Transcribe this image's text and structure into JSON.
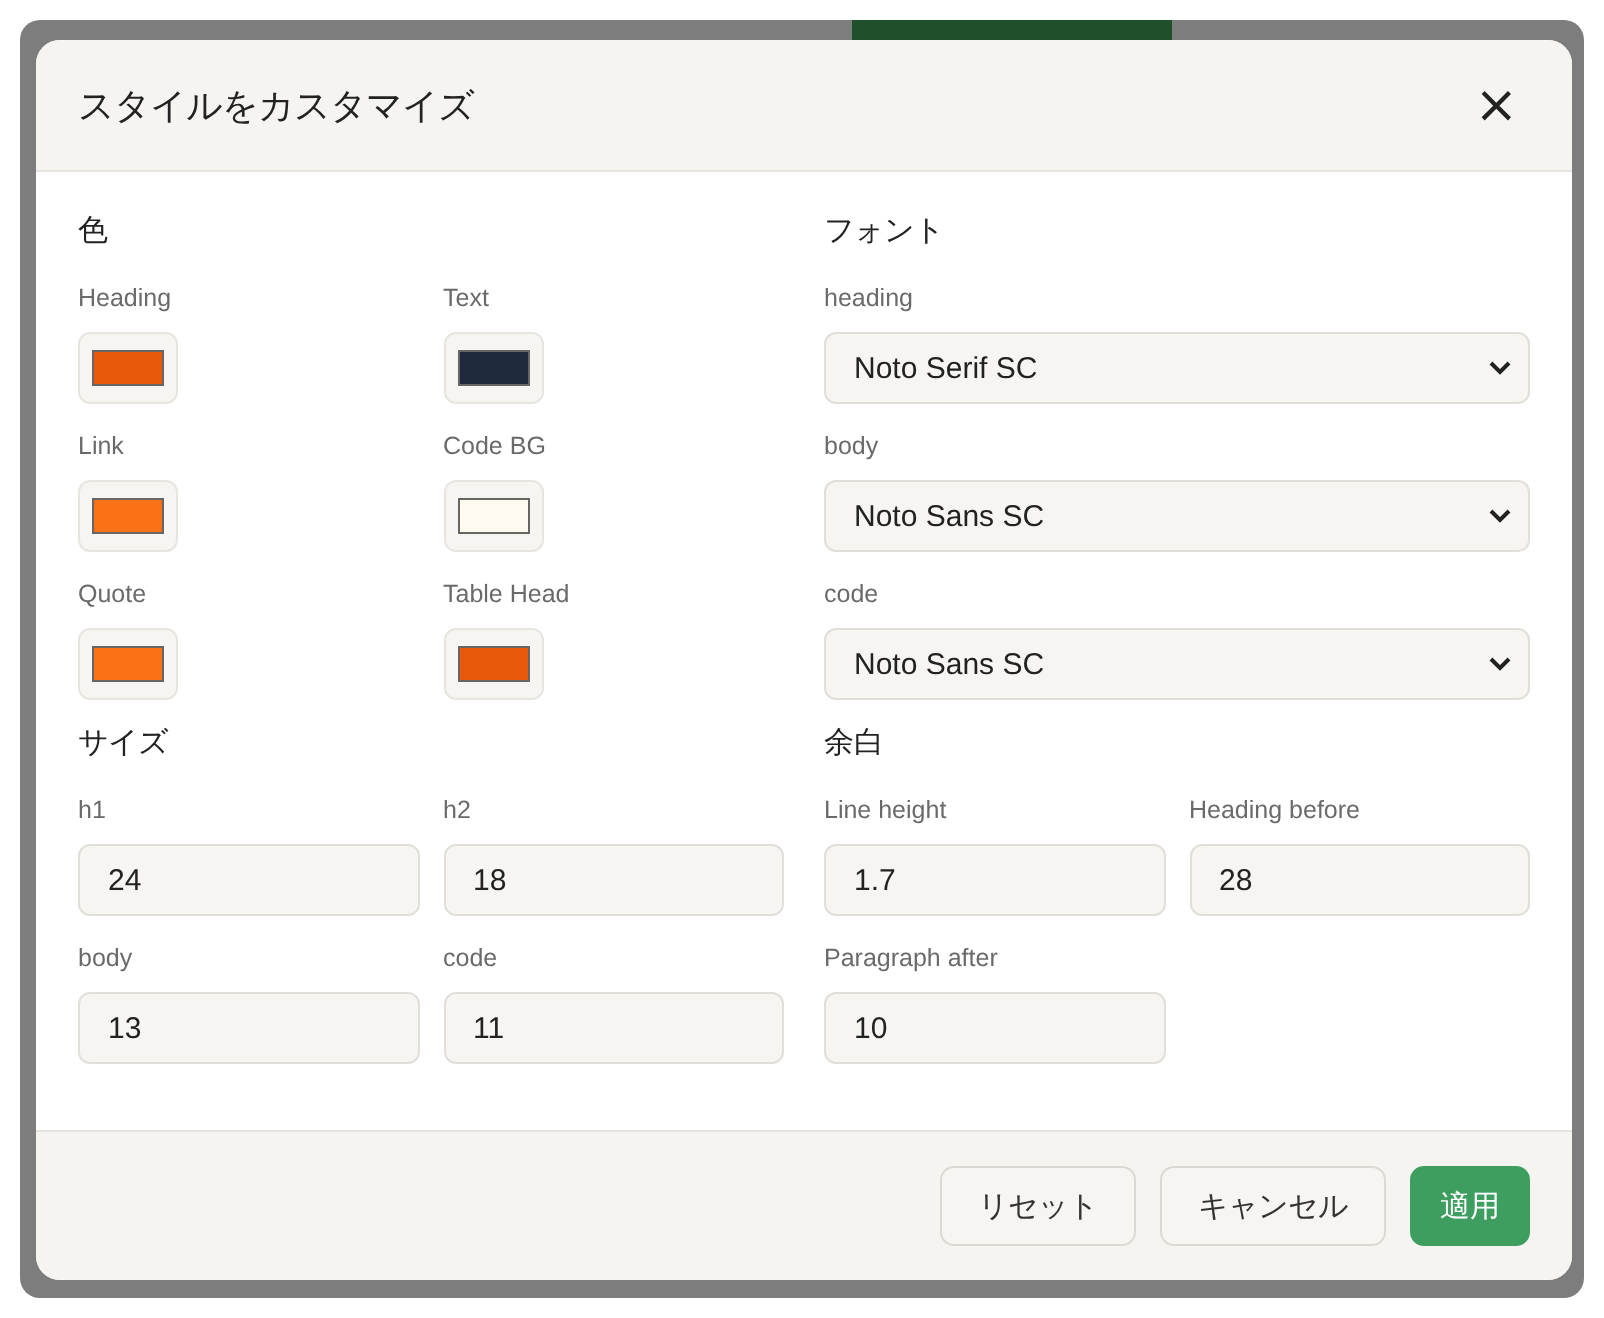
{
  "dialog": {
    "title": "スタイルをカスタマイズ",
    "close": "×"
  },
  "colors": {
    "heading": "色",
    "items": [
      {
        "label": "Heading",
        "color": "#e8590c"
      },
      {
        "label": "Text",
        "color": "#1e293b"
      },
      {
        "label": "Link",
        "color": "#f97316"
      },
      {
        "label": "Code BG",
        "color": "#fffbf0"
      },
      {
        "label": "Quote",
        "color": "#f97316"
      },
      {
        "label": "Table Head",
        "color": "#e8590c"
      }
    ]
  },
  "fonts": {
    "heading": "フォント",
    "items": [
      {
        "label": "heading",
        "value": "Noto Serif SC"
      },
      {
        "label": "body",
        "value": "Noto Sans SC"
      },
      {
        "label": "code",
        "value": "Noto Sans SC"
      }
    ]
  },
  "sizes": {
    "heading": "サイズ",
    "items": [
      {
        "label": "h1",
        "value": "24"
      },
      {
        "label": "h2",
        "value": "18"
      },
      {
        "label": "body",
        "value": "13"
      },
      {
        "label": "code",
        "value": "11"
      }
    ]
  },
  "spacing": {
    "heading": "余白",
    "items": [
      {
        "label": "Line height",
        "value": "1.7"
      },
      {
        "label": "Heading before",
        "value": "28"
      },
      {
        "label": "Paragraph after",
        "value": "10"
      }
    ]
  },
  "buttons": [
    {
      "label": "リセット",
      "kind": "secondary"
    },
    {
      "label": "キャンセル",
      "kind": "secondary"
    },
    {
      "label": "適用",
      "kind": "primary"
    }
  ]
}
